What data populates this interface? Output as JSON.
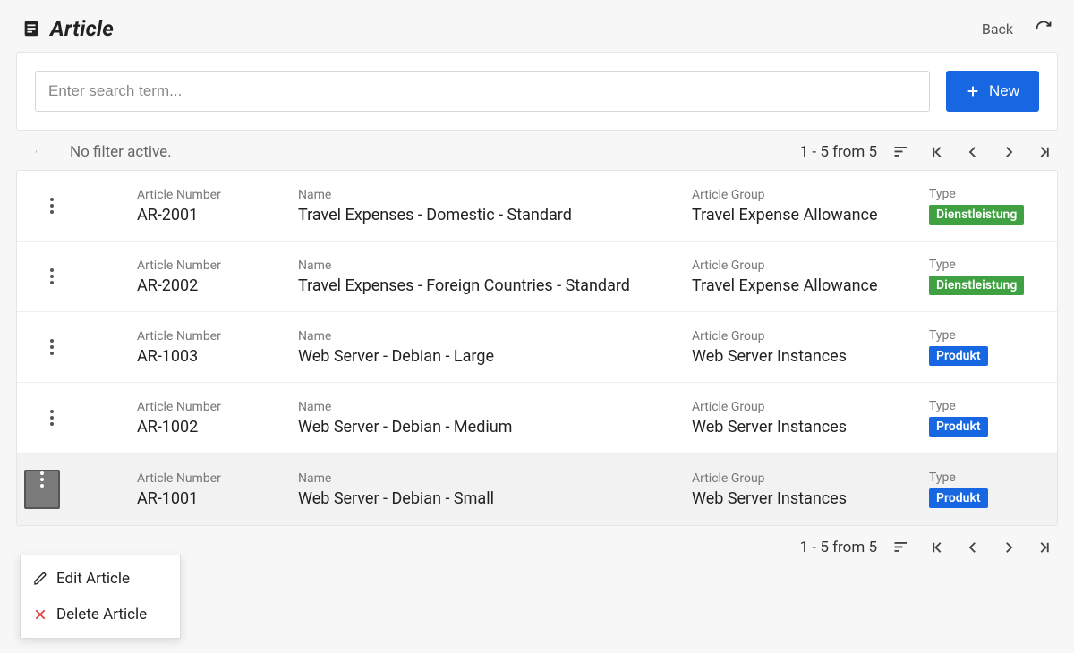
{
  "header": {
    "title": "Article",
    "back_label": "Back"
  },
  "search": {
    "placeholder": "Enter search term...",
    "new_label": "New"
  },
  "filter": {
    "status": "No filter active.",
    "page_info": "1 - 5 from 5"
  },
  "columns": {
    "article_number": "Article Number",
    "name": "Name",
    "article_group": "Article Group",
    "type": "Type"
  },
  "rows": [
    {
      "number": "AR-2001",
      "name": "Travel Expenses - Domestic - Standard",
      "group": "Travel Expense Allowance",
      "type_label": "Dienstleistung",
      "type_color": "green"
    },
    {
      "number": "AR-2002",
      "name": "Travel Expenses - Foreign Countries - Standard",
      "group": "Travel Expense Allowance",
      "type_label": "Dienstleistung",
      "type_color": "green"
    },
    {
      "number": "AR-1003",
      "name": "Web Server - Debian - Large",
      "group": "Web Server Instances",
      "type_label": "Produkt",
      "type_color": "blue"
    },
    {
      "number": "AR-1002",
      "name": "Web Server - Debian - Medium",
      "group": "Web Server Instances",
      "type_label": "Produkt",
      "type_color": "blue"
    },
    {
      "number": "AR-1001",
      "name": "Web Server - Debian - Small",
      "group": "Web Server Instances",
      "type_label": "Produkt",
      "type_color": "blue"
    }
  ],
  "context_menu": {
    "edit": "Edit Article",
    "delete": "Delete Article"
  },
  "active_row_index": 4
}
